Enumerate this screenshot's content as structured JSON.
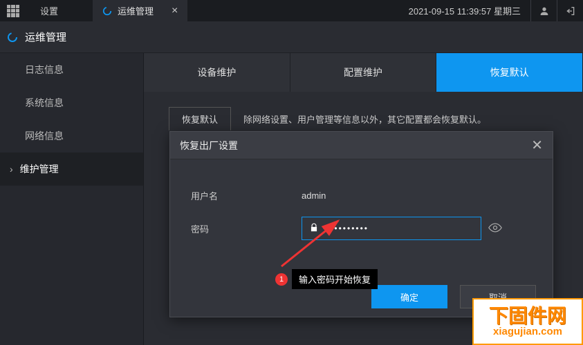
{
  "topbar": {
    "settings_label": "设置",
    "tab_label": "运维管理",
    "datetime": "2021-09-15 11:39:57 星期三"
  },
  "page_title": "运维管理",
  "sidebar": {
    "items": [
      {
        "label": "日志信息"
      },
      {
        "label": "系统信息"
      },
      {
        "label": "网络信息"
      },
      {
        "label": "维护管理"
      }
    ]
  },
  "tabs": [
    {
      "label": "设备维护"
    },
    {
      "label": "配置维护"
    },
    {
      "label": "恢复默认"
    }
  ],
  "subtab": {
    "label": "恢复默认",
    "desc": "除网络设置、用户管理等信息以外，其它配置都会恢复默认。"
  },
  "modal": {
    "title": "恢复出厂设置",
    "user_label": "用户名",
    "user_value": "admin",
    "pwd_label": "密码",
    "pwd_mask": "••••••••••",
    "ok_label": "确定",
    "cancel_label": "取消"
  },
  "callout": {
    "num": "1",
    "text": "输入密码开始恢复"
  },
  "watermark": {
    "cn": "下固件网",
    "url": "xiagujian.com"
  }
}
